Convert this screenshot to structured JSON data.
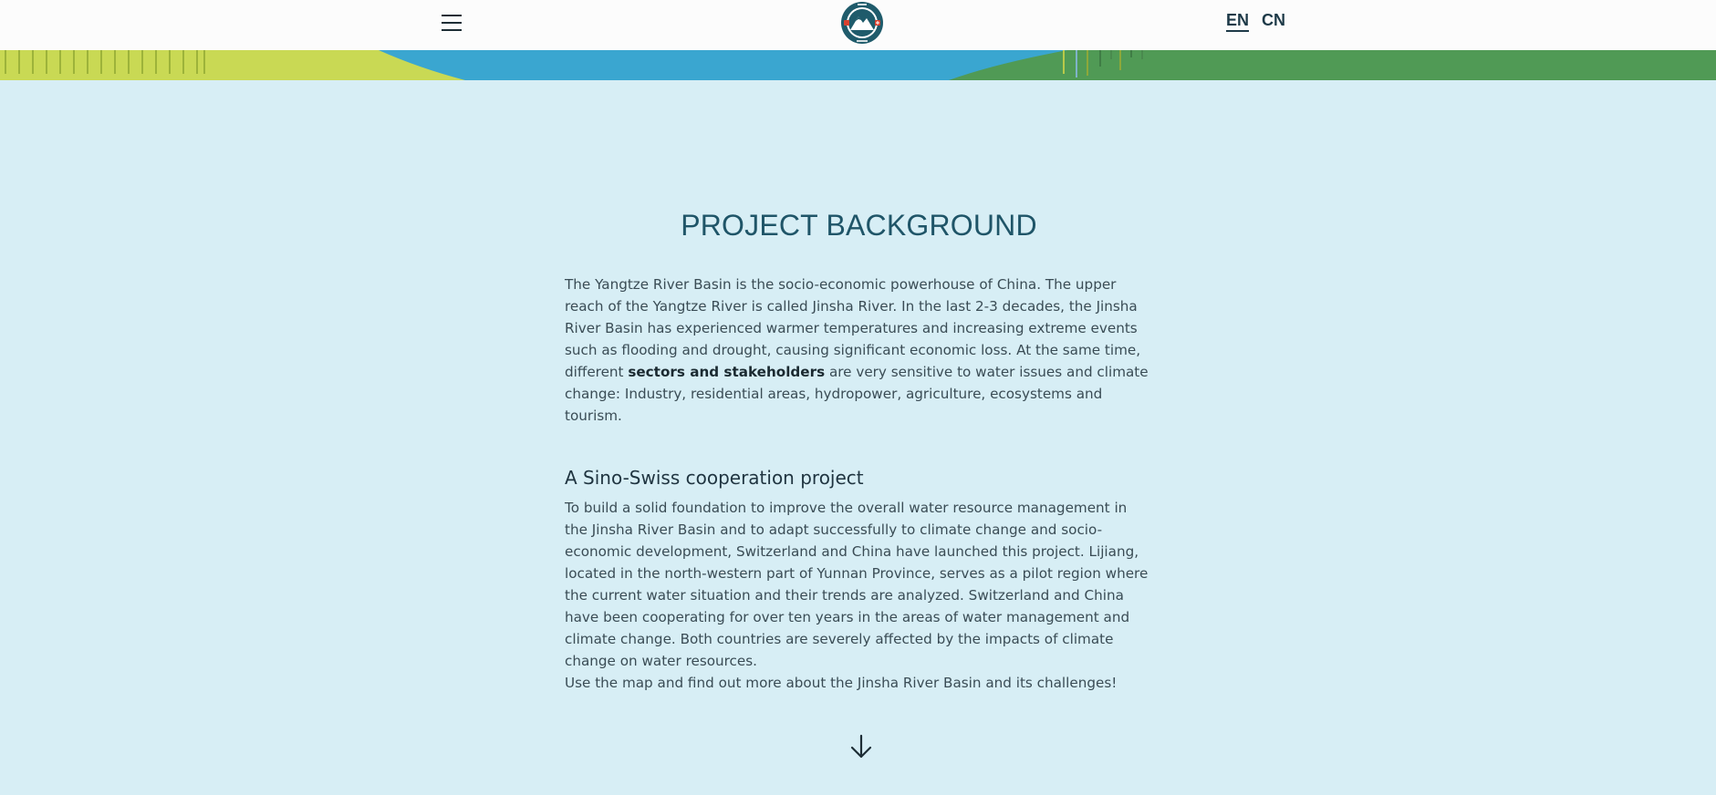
{
  "header": {
    "languages": [
      {
        "label": "EN",
        "active": true
      },
      {
        "label": "CN",
        "active": false
      }
    ]
  },
  "main": {
    "title": "PROJECT BACKGROUND",
    "intro_part1": "The Yangtze River Basin is the socio-economic powerhouse of China. The upper reach of the Yangtze River is called Jinsha River. In the last 2-3 decades, the Jinsha River Basin has experienced warmer temperatures and increasing extreme events such as flooding and drought, causing significant economic loss. At the same time, different ",
    "intro_bold": "sectors and stakeholders",
    "intro_part2": " are very sensitive to water issues and climate change: Industry, residential areas, hydropower, agriculture, ecosystems and tourism.",
    "subheading": "A Sino-Swiss cooperation project",
    "cooperation_text": "To build a solid foundation to improve the overall water resource management in the Jinsha River Basin and to adapt successfully to climate change and socio-economic development, Switzerland and China have launched this project. Lijiang, located in the north-western part of Yunnan Province, serves as a pilot region where the current water situation and their trends are analyzed. Switzerland and China have been cooperating for over ten years in the areas of water management and climate change. Both countries are severely affected by the impacts of climate change on water resources.",
    "cta_text": "Use the map and find out more about the Jinsha River Basin and its challenges!"
  },
  "icons": {
    "menu": "hamburger-menu-icon",
    "logo": "mountain-logo-icon",
    "scroll": "arrow-down-icon"
  },
  "colors": {
    "background": "#d7eef5",
    "title": "#1f5568",
    "band_lime": "#c9d954",
    "band_blue": "#3aa6d0",
    "band_green": "#509a55",
    "logo_teal": "#1f5b6b",
    "logo_red": "#d9412f"
  }
}
